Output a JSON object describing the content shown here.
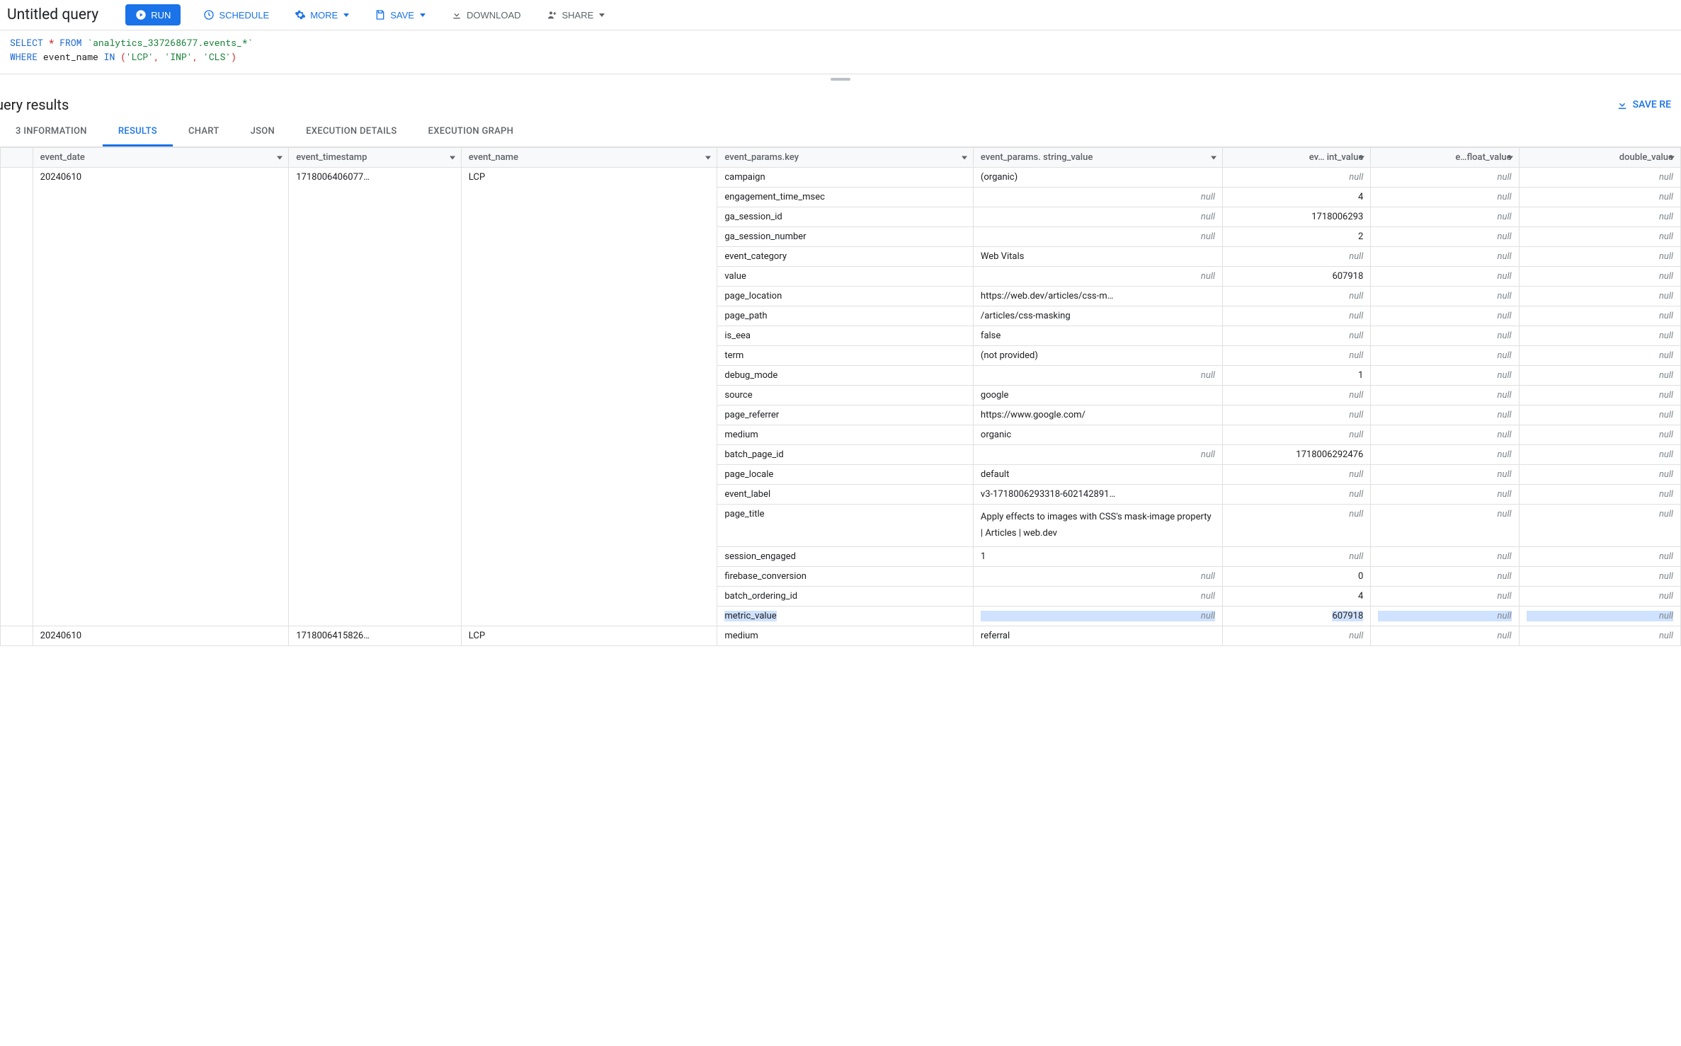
{
  "toolbar": {
    "title": "Untitled query",
    "run": "RUN",
    "schedule": "SCHEDULE",
    "more": "MORE",
    "save": "SAVE",
    "download": "DOWNLOAD",
    "share": "SHARE"
  },
  "sql": {
    "line1": {
      "select": "SELECT",
      "star": "*",
      "from": "FROM",
      "table": "`analytics_337268677.events_*`"
    },
    "line2": {
      "where": "WHERE",
      "col": "event_name",
      "in": "IN",
      "vals": [
        "'LCP'",
        "'INP'",
        "'CLS'"
      ]
    }
  },
  "results": {
    "title": "uery results",
    "save_btn": "SAVE RE"
  },
  "tabs": [
    "3 INFORMATION",
    "RESULTS",
    "CHART",
    "JSON",
    "EXECUTION DETAILS",
    "EXECUTION GRAPH"
  ],
  "columns": [
    "event_date",
    "event_timestamp",
    "event_name",
    "event_params.key",
    "event_params. string_value",
    "ev… int_value",
    "e…float_value",
    "double_value"
  ],
  "rows": [
    {
      "event_date": "20240610",
      "event_timestamp": "1718006406077…",
      "event_name": "LCP",
      "params": [
        {
          "key": "campaign",
          "str": "(organic)",
          "int": null,
          "float": null,
          "double": null
        },
        {
          "key": "engagement_time_msec",
          "str": null,
          "int": "4",
          "float": null,
          "double": null
        },
        {
          "key": "ga_session_id",
          "str": null,
          "int": "1718006293",
          "float": null,
          "double": null
        },
        {
          "key": "ga_session_number",
          "str": null,
          "int": "2",
          "float": null,
          "double": null
        },
        {
          "key": "event_category",
          "str": "Web Vitals",
          "int": null,
          "float": null,
          "double": null
        },
        {
          "key": "value",
          "str": null,
          "int": "607918",
          "float": null,
          "double": null
        },
        {
          "key": "page_location",
          "str": "https://web.dev/articles/css-m…",
          "int": null,
          "float": null,
          "double": null
        },
        {
          "key": "page_path",
          "str": "/articles/css-masking",
          "int": null,
          "float": null,
          "double": null
        },
        {
          "key": "is_eea",
          "str": "false",
          "int": null,
          "float": null,
          "double": null
        },
        {
          "key": "term",
          "str": "(not provided)",
          "int": null,
          "float": null,
          "double": null
        },
        {
          "key": "debug_mode",
          "str": null,
          "int": "1",
          "float": null,
          "double": null
        },
        {
          "key": "source",
          "str": "google",
          "int": null,
          "float": null,
          "double": null
        },
        {
          "key": "page_referrer",
          "str": "https://www.google.com/",
          "int": null,
          "float": null,
          "double": null
        },
        {
          "key": "medium",
          "str": "organic",
          "int": null,
          "float": null,
          "double": null
        },
        {
          "key": "batch_page_id",
          "str": null,
          "int": "1718006292476",
          "float": null,
          "double": null
        },
        {
          "key": "page_locale",
          "str": "default",
          "int": null,
          "float": null,
          "double": null
        },
        {
          "key": "event_label",
          "str": "v3-1718006293318-602142891…",
          "int": null,
          "float": null,
          "double": null
        },
        {
          "key": "page_title",
          "str": "Apply effects to images with CSS's mask-image property  |  Articles  |  web.dev",
          "int": null,
          "float": null,
          "double": null,
          "wrap": true
        },
        {
          "key": "session_engaged",
          "str": "1",
          "int": null,
          "float": null,
          "double": null
        },
        {
          "key": "firebase_conversion",
          "str": null,
          "int": "0",
          "float": null,
          "double": null
        },
        {
          "key": "batch_ordering_id",
          "str": null,
          "int": "4",
          "float": null,
          "double": null
        },
        {
          "key": "metric_value",
          "str": null,
          "int": "607918",
          "float": null,
          "double": null,
          "highlight": true
        }
      ]
    },
    {
      "event_date": "20240610",
      "event_timestamp": "1718006415826…",
      "event_name": "LCP",
      "params": [
        {
          "key": "medium",
          "str": "referral",
          "int": null,
          "float": null,
          "double": null
        }
      ]
    }
  ],
  "null_text": "null"
}
